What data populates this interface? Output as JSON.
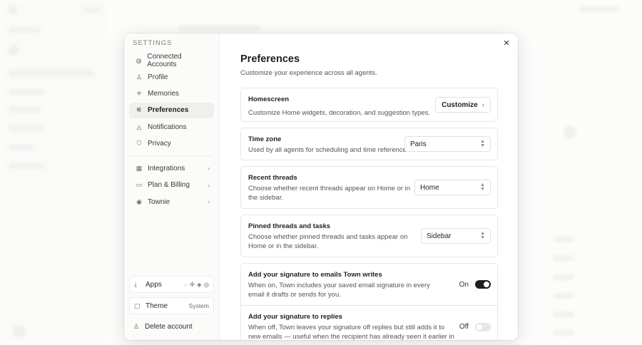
{
  "settings": {
    "heading": "SETTINGS",
    "nav": [
      {
        "label": "Connected Accounts",
        "icon": "globe-icon"
      },
      {
        "label": "Profile",
        "icon": "person-icon"
      },
      {
        "label": "Memories",
        "icon": "sparkle-icon"
      },
      {
        "label": "Preferences",
        "icon": "sliders-icon",
        "active": true
      },
      {
        "label": "Notifications",
        "icon": "bell-icon"
      },
      {
        "label": "Privacy",
        "icon": "shield-icon"
      }
    ],
    "nav2": [
      {
        "label": "Integrations",
        "icon": "grid-icon"
      },
      {
        "label": "Plan & Billing",
        "icon": "card-icon"
      },
      {
        "label": "Townie",
        "icon": "bot-icon"
      }
    ],
    "apps_label": "Apps",
    "theme_label": "Theme",
    "theme_value": "System",
    "delete_label": "Delete account"
  },
  "preferences": {
    "title": "Preferences",
    "subtitle": "Customize your experience across all agents.",
    "homescreen": {
      "title": "Homescreen",
      "desc": "Customize Home widgets, decoration, and suggestion types.",
      "button": "Customize"
    },
    "timezone": {
      "title": "Time zone",
      "desc": "Used by all agents for scheduling and time references.",
      "value": "Paris"
    },
    "recent": {
      "title": "Recent threads",
      "desc": "Choose whether recent threads appear on Home or in the sidebar.",
      "value": "Home"
    },
    "pinned": {
      "title": "Pinned threads and tasks",
      "desc": "Choose whether pinned threads and tasks appear on Home or in the sidebar.",
      "value": "Sidebar"
    },
    "signature_writes": {
      "title": "Add your signature to emails Town writes",
      "desc": "When on, Town includes your saved email signature in every email it drafts or sends for you.",
      "state": "On"
    },
    "signature_replies": {
      "title": "Add your signature to replies",
      "desc": "When off, Town leaves your signature off replies but still adds it to new emails — useful when the recipient has already seen it earlier in the",
      "state": "Off"
    }
  },
  "colors": {
    "accent": "#1f1f1d",
    "border": "#e6e6e3"
  }
}
